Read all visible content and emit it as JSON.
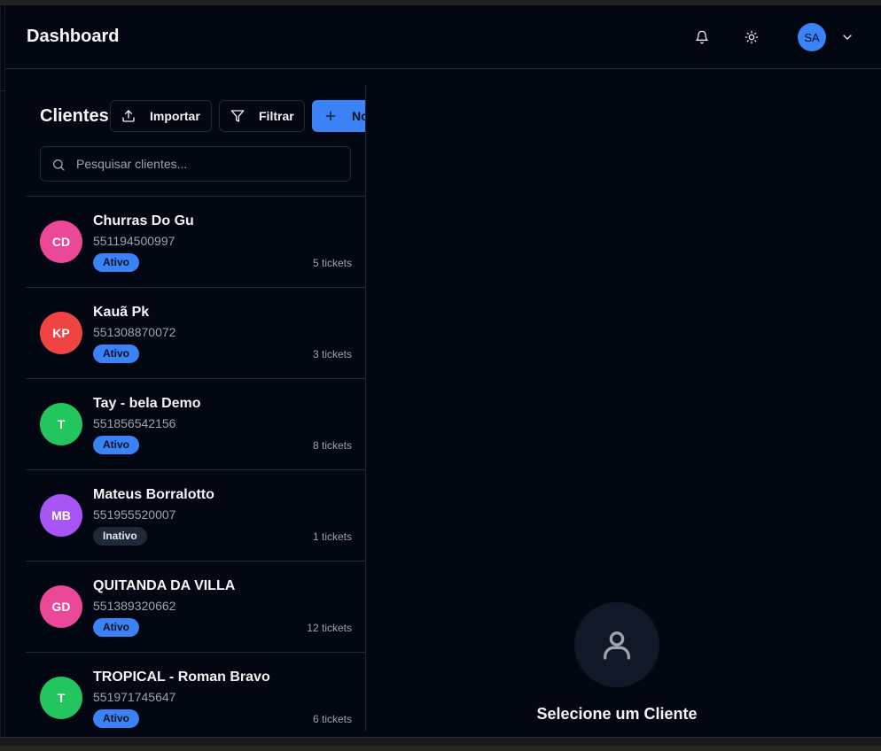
{
  "header": {
    "title": "Dashboard",
    "avatar_initials": "SA"
  },
  "clients_panel": {
    "title": "Clientes",
    "import_label": "Importar",
    "filter_label": "Filtrar",
    "new_label": "No",
    "search_placeholder": "Pesquisar clientes...",
    "clients": [
      {
        "initials": "CD",
        "name": "Churras Do Gu",
        "phone": "551194500997",
        "status": "Ativo",
        "tickets": "5 tickets",
        "avatar_color": "#ec4899"
      },
      {
        "initials": "KP",
        "name": "Kauã Pk",
        "phone": "551308870072",
        "status": "Ativo",
        "tickets": "3 tickets",
        "avatar_color": "#ef4444"
      },
      {
        "initials": "T",
        "name": "Tay - bela Demo",
        "phone": "551856542156",
        "status": "Ativo",
        "tickets": "8 tickets",
        "avatar_color": "#22c55e"
      },
      {
        "initials": "MB",
        "name": "Mateus Borralotto",
        "phone": "551955520007",
        "status": "Inativo",
        "tickets": "1 tickets",
        "avatar_color": "#a855f7"
      },
      {
        "initials": "GD",
        "name": "QUITANDA DA VILLA",
        "phone": "551389320662",
        "status": "Ativo",
        "tickets": "12 tickets",
        "avatar_color": "#ec4899"
      },
      {
        "initials": "T",
        "name": "TROPICAL - Roman Bravo",
        "phone": "551971745647",
        "status": "Ativo",
        "tickets": "6 tickets",
        "avatar_color": "#22c55e"
      }
    ]
  },
  "empty_state": {
    "label": "Selecione um Cliente"
  },
  "colors": {
    "accent": "#3b82f6",
    "background": "#030712",
    "border": "#1f2937"
  }
}
